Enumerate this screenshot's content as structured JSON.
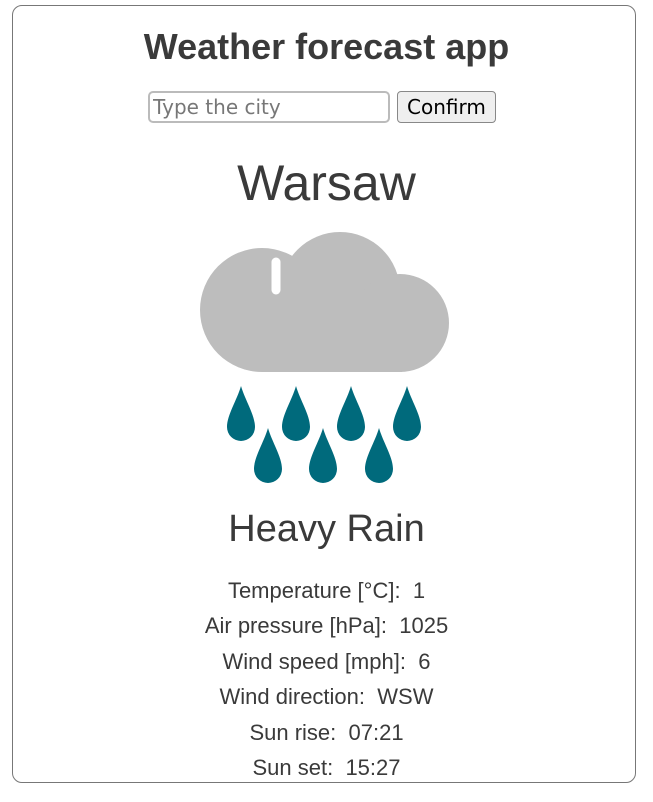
{
  "header": {
    "title": "Weather forecast app"
  },
  "search": {
    "placeholder": "Type the city",
    "value": "",
    "confirm_label": "Confirm"
  },
  "weather": {
    "city": "Warsaw",
    "icon": "heavy-rain-icon",
    "colors": {
      "cloud": "#bdbdbd",
      "drops": "#006a7c"
    },
    "description": "Heavy Rain",
    "stats": [
      {
        "label": "Temperature [°C]:",
        "value": "1"
      },
      {
        "label": "Air pressure [hPa]:",
        "value": "1025"
      },
      {
        "label": "Wind speed [mph]:",
        "value": "6"
      },
      {
        "label": "Wind direction:",
        "value": "WSW"
      },
      {
        "label": "Sun rise:",
        "value": "07:21"
      },
      {
        "label": "Sun set:",
        "value": "15:27"
      }
    ]
  }
}
